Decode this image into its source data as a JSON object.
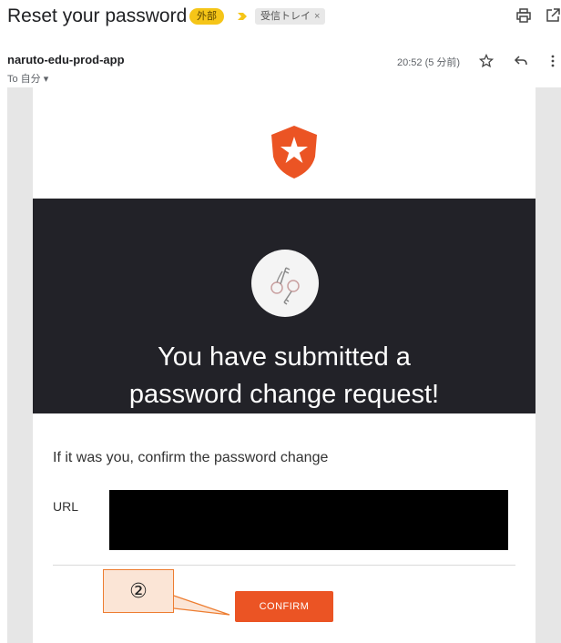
{
  "header": {
    "subject": "Reset your password",
    "external_badge": "外部",
    "inbox_label": "受信トレイ",
    "inbox_close": "×"
  },
  "sender": {
    "name": "naruto-edu-prod-app",
    "recipient": "To 自分 ▾",
    "timestamp": "20:52 (5 分前)"
  },
  "icons": {
    "importance": "importance-marker-icon",
    "print": "print-icon",
    "popout": "open-in-new-window-icon",
    "star": "star-icon",
    "reply": "reply-icon",
    "more": "more-vertical-icon",
    "logo": "auth0-logo-icon",
    "keys": "keys-icon"
  },
  "email": {
    "hero_title_line1": "You have submitted a",
    "hero_title_line2": "password change request!",
    "body_text": "If it was you, confirm the password change",
    "url_label": "URL",
    "url_value": "",
    "confirm_label": "CONFIRM"
  },
  "annotation": {
    "step": "②"
  },
  "colors": {
    "brand_orange": "#eb5424",
    "hero_background": "#222228",
    "badge_yellow": "#f5c518",
    "callout_fill": "#fbe5d6",
    "callout_border": "#ed7d31"
  }
}
